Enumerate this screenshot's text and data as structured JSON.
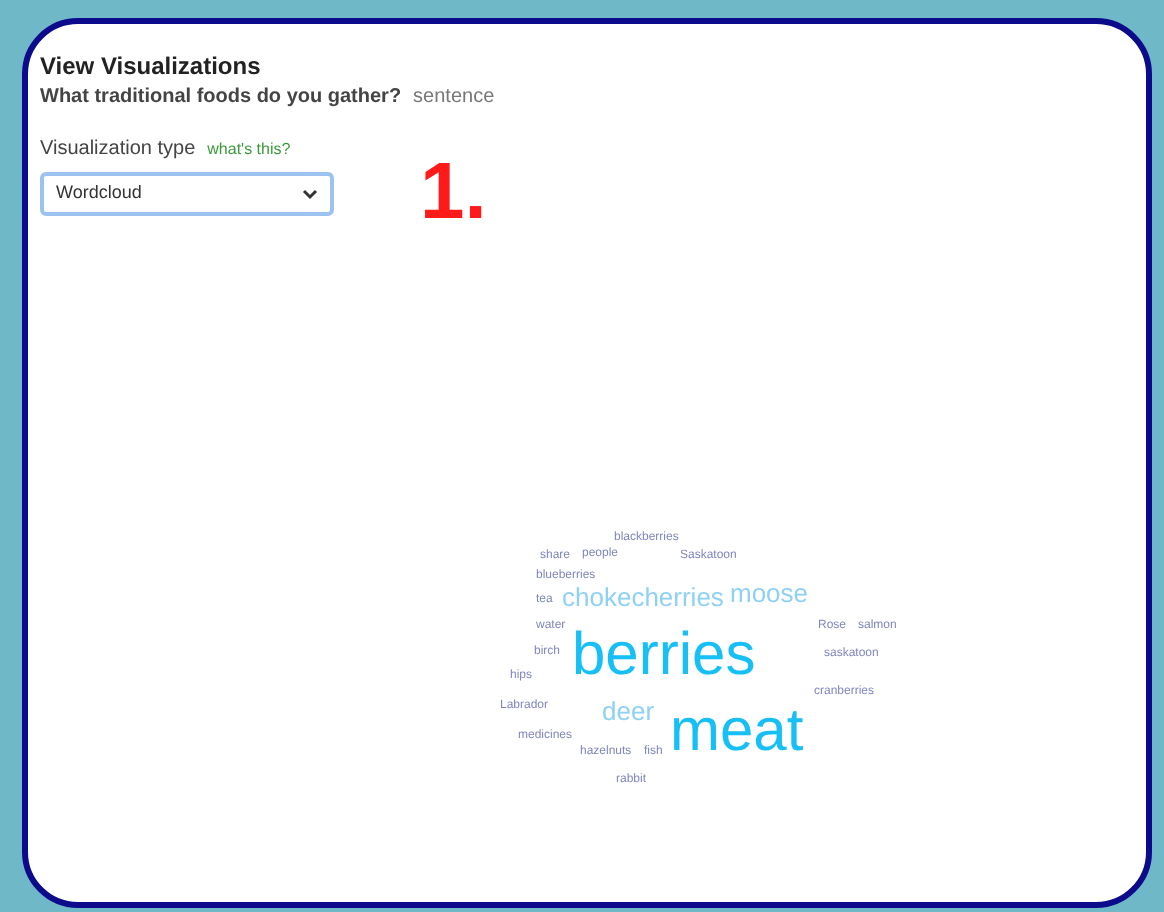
{
  "header": {
    "title": "View Visualizations",
    "question": "What traditional foods do you gather?",
    "question_type": "sentence"
  },
  "controls": {
    "label": "Visualization type",
    "help_link": "what's this?",
    "select_value": "Wordcloud"
  },
  "step_marker": "1.",
  "wordcloud": [
    {
      "text": "blackberries",
      "kind": "small"
    },
    {
      "text": "share",
      "kind": "small"
    },
    {
      "text": "people",
      "kind": "small"
    },
    {
      "text": "Saskatoon",
      "kind": "small"
    },
    {
      "text": "blueberries",
      "kind": "small"
    },
    {
      "text": "tea",
      "kind": "small"
    },
    {
      "text": "chokecherries",
      "kind": "medium"
    },
    {
      "text": "moose",
      "kind": "medium"
    },
    {
      "text": "water",
      "kind": "small"
    },
    {
      "text": "Rose",
      "kind": "small"
    },
    {
      "text": "salmon",
      "kind": "small"
    },
    {
      "text": "birch",
      "kind": "small"
    },
    {
      "text": "berries",
      "kind": "large"
    },
    {
      "text": "saskatoon",
      "kind": "small"
    },
    {
      "text": "hips",
      "kind": "small"
    },
    {
      "text": "cranberries",
      "kind": "small"
    },
    {
      "text": "Labrador",
      "kind": "small"
    },
    {
      "text": "deer",
      "kind": "medium"
    },
    {
      "text": "medicines",
      "kind": "small"
    },
    {
      "text": "hazelnuts",
      "kind": "small"
    },
    {
      "text": "fish",
      "kind": "small"
    },
    {
      "text": "meat",
      "kind": "large"
    },
    {
      "text": "rabbit",
      "kind": "small"
    }
  ]
}
